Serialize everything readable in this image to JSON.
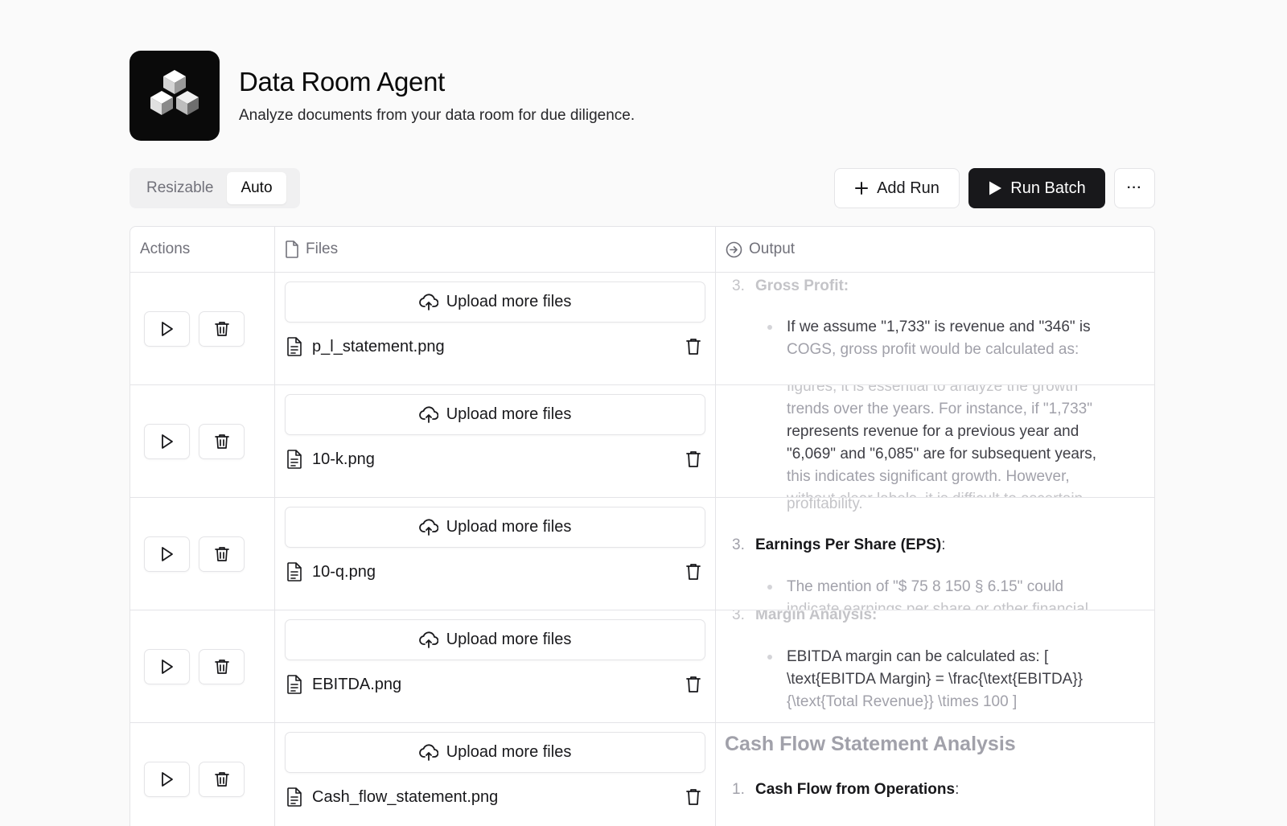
{
  "app": {
    "title": "Data Room Agent",
    "subtitle": "Analyze documents from your data room for due diligence.",
    "logo_icon": "stacked-cubes-icon"
  },
  "view_toggle": {
    "options": [
      "Resizable",
      "Auto"
    ],
    "selected": "Auto"
  },
  "toolbar": {
    "add_run_label": "Add Run",
    "run_batch_label": "Run Batch",
    "more_label": "···"
  },
  "table": {
    "headers": {
      "actions": "Actions",
      "files": "Files",
      "output": "Output"
    },
    "upload_label": "Upload more files",
    "rows": [
      {
        "file": "p_l_statement.png",
        "output": {
          "num": "3.",
          "l1": "Gross Profit:",
          "l2": "If we assume \"1,733\" is revenue and \"346\" is",
          "l3": "COGS, gross profit would be calculated as:"
        }
      },
      {
        "file": "10-k.png",
        "output": {
          "l0": "figures, it is essential to analyze the growth",
          "l1": "trends over the years. For instance, if \"1,733\"",
          "l2": "represents revenue for a previous year and",
          "l3": "\"6,069\" and \"6,085\" are for subsequent years,",
          "l4": "this indicates significant growth. However,",
          "l5": "without clear labels, it is difficult to ascertain"
        }
      },
      {
        "file": "10-q.png",
        "output": {
          "l0": "profitability.",
          "num": "3.",
          "l1": "Earnings Per Share (EPS)",
          "l1_suffix": ":",
          "l2": "The mention of \"$ 75 8 150 § 6.15\" could",
          "l3": "indicate earnings per share or other financial"
        }
      },
      {
        "file": "EBITDA.png",
        "output": {
          "num": "3.",
          "l0": "Margin Analysis:",
          "l1": "EBITDA margin can be calculated as: [",
          "l2": "\\text{EBITDA Margin} = \\frac{\\text{EBITDA}}",
          "l3": "{\\text{Total Revenue}} \\times 100 ]"
        }
      },
      {
        "file": "Cash_flow_statement.png",
        "output": {
          "heading": "Cash Flow Statement Analysis",
          "num": "1.",
          "l1": "Cash Flow from Operations",
          "l1_suffix": ":"
        }
      }
    ]
  }
}
